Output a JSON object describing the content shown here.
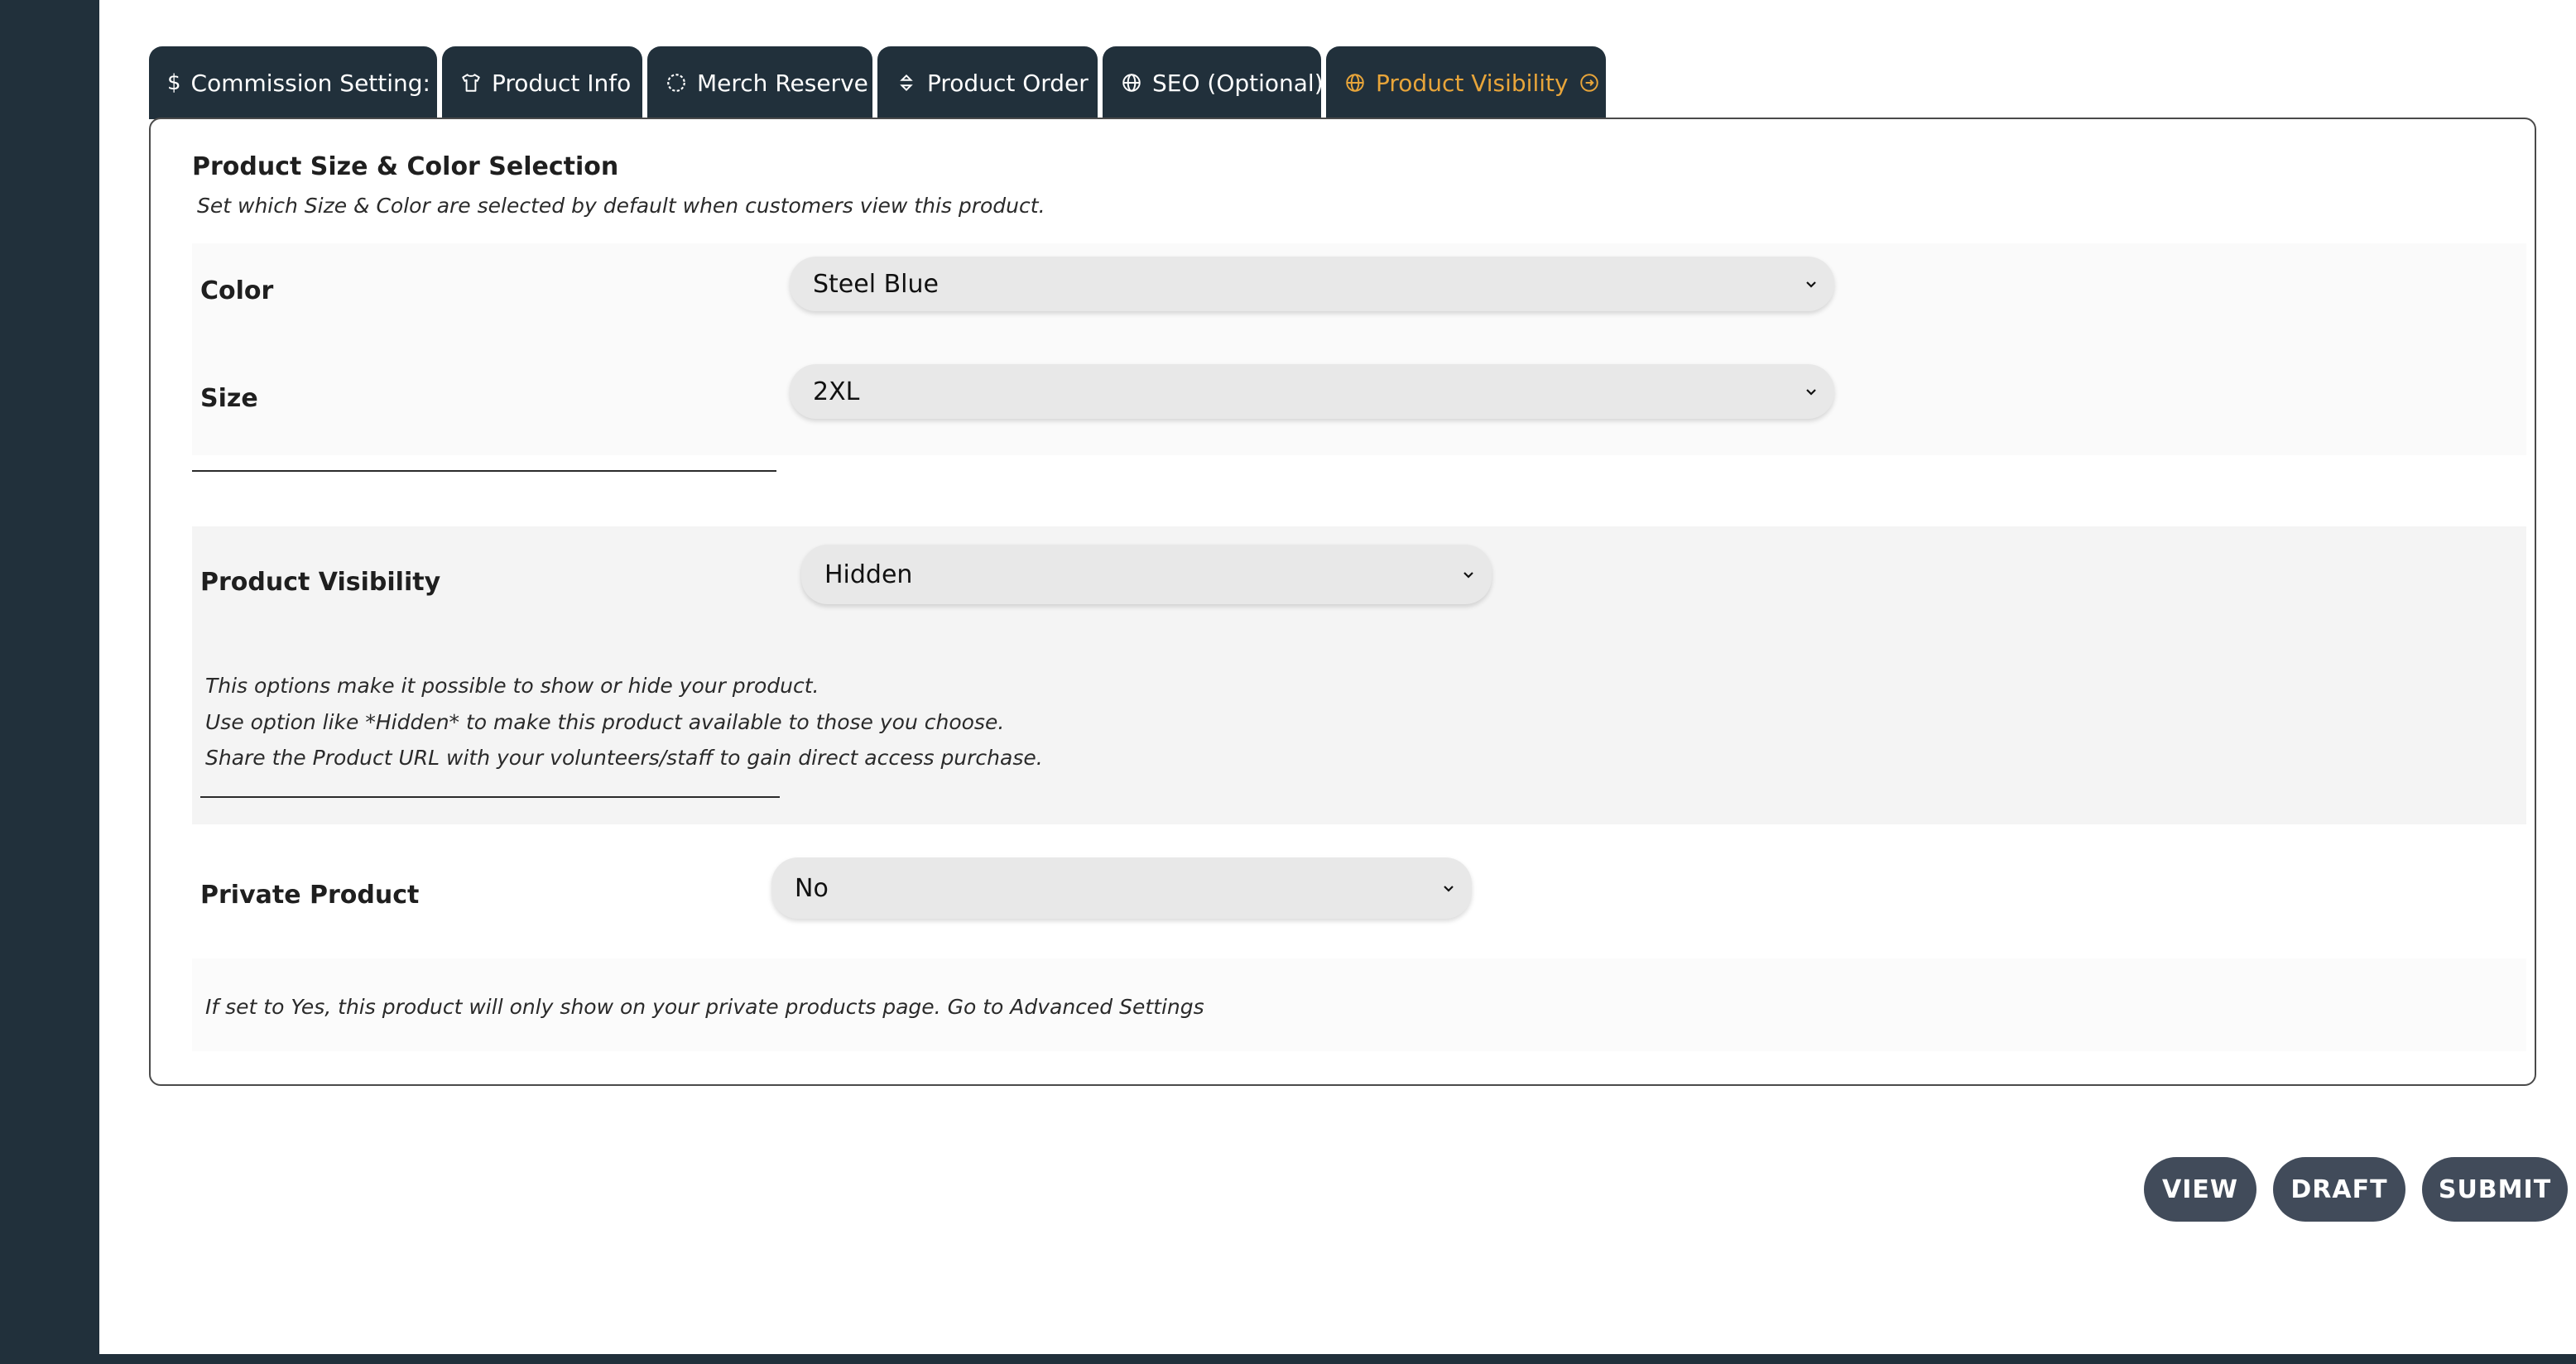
{
  "tabs": [
    {
      "label": "Commission Setting:",
      "icon": "dollar-icon"
    },
    {
      "label": "Product Info",
      "icon": "tshirt-icon"
    },
    {
      "label": "Merch Reserve",
      "icon": "spinner-icon"
    },
    {
      "label": "Product Order",
      "icon": "sort-icon"
    },
    {
      "label": "SEO (Optional)",
      "icon": "globe-icon"
    },
    {
      "label": "Product Visibility",
      "icon": "globe-icon",
      "active": true
    }
  ],
  "tab_icon_glyphs": {
    "dollar": "$"
  },
  "colors": {
    "dark": "#21303b",
    "active_tab": "#e8a53a",
    "button": "#414b5a"
  },
  "size_color": {
    "title": "Product Size & Color Selection",
    "description": "Set which Size & Color are selected by default when customers view this product.",
    "color_label": "Color",
    "color_value": "Steel Blue",
    "size_label": "Size",
    "size_value": "2XL"
  },
  "visibility": {
    "label": "Product Visibility",
    "value": "Hidden",
    "notes": [
      "This options make it possible to show or hide your product.",
      "Use option like *Hidden* to make this product available to those you choose.",
      "Share the Product URL with your volunteers/staff to gain direct access purchase."
    ]
  },
  "private_product": {
    "label": "Private Product",
    "value": "No",
    "note": "If set to Yes, this product will only show on your private products page.",
    "link": "Go to Advanced Settings"
  },
  "buttons": {
    "view": "VIEW",
    "draft": "DRAFT",
    "submit": "SUBMIT"
  }
}
